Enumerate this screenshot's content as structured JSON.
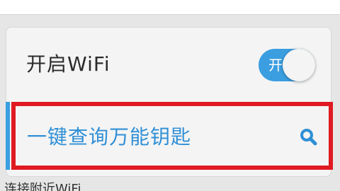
{
  "wifi": {
    "label": "开启WiFi",
    "toggle_text": "开",
    "toggle_on": true
  },
  "key_lookup": {
    "label": "一键查询万能钥匙"
  },
  "section": {
    "partial_header": "连接附近WiFi"
  },
  "colors": {
    "accent": "#3b9ee0",
    "highlight": "#e01a22",
    "link_text": "#2f8fd6"
  },
  "icons": {
    "search": "search-icon"
  }
}
